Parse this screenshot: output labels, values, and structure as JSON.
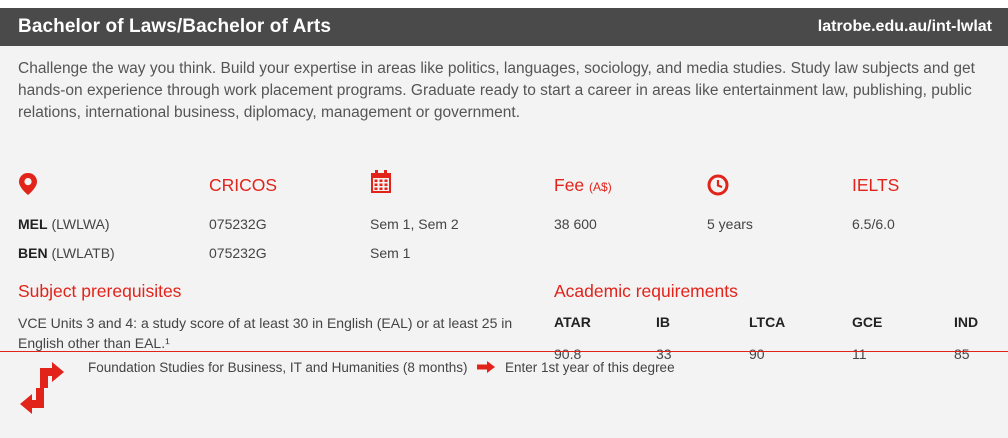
{
  "header": {
    "title": "Bachelor of Laws/Bachelor of Arts",
    "url": "latrobe.edu.au/int-lwlat"
  },
  "intro": "Challenge the way you think. Build your expertise in areas like politics, languages, sociology, and media studies. Study law subjects and get hands-on experience through work placement programs. Graduate ready to start a career in areas like entertainment law, publishing, public relations, international business, diplomacy, management or government.",
  "columns": {
    "cricos": "CRICOS",
    "fee": "Fee",
    "fee_unit": "(A$)",
    "ielts": "IELTS"
  },
  "icons": {
    "location": "location-pin-icon",
    "calendar": "calendar-icon",
    "duration": "clock-icon",
    "pathway": "pathway-arrows-icon",
    "arrow": "arrow-right-icon"
  },
  "campuses": [
    {
      "campus": "MEL",
      "code": "(LWLWA)",
      "cricos": "075232G",
      "intake": "Sem 1, Sem 2",
      "fee": "38 600",
      "duration": "5 years",
      "ielts": "6.5/6.0"
    },
    {
      "campus": "BEN",
      "code": "(LWLATB)",
      "cricos": "075232G",
      "intake": "Sem 1"
    }
  ],
  "prerequisites": {
    "heading": "Subject prerequisites",
    "text": "VCE Units 3 and 4: a study score of at least 30 in English (EAL) or at least 25 in English other than EAL.¹"
  },
  "academic": {
    "heading": "Academic requirements",
    "columns": [
      "ATAR",
      "IB",
      "LTCA",
      "GCE",
      "IND"
    ],
    "values": [
      "90.8",
      "33",
      "90",
      "11",
      "85"
    ]
  },
  "pathway": {
    "from": "Foundation Studies for Business, IT and Humanities (8 months)",
    "to": "Enter 1st year of this degree"
  },
  "colors": {
    "accent": "#e2231a",
    "header_bg": "#4a4a4a",
    "body_bg": "#f3f3f3"
  }
}
